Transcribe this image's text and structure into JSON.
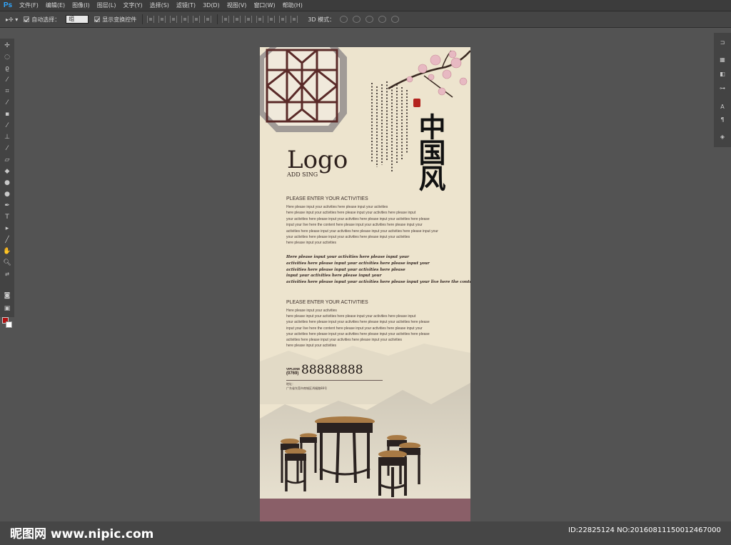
{
  "app": {
    "logo": "Ps"
  },
  "menu": [
    "文件(F)",
    "编辑(E)",
    "图像(I)",
    "图层(L)",
    "文字(Y)",
    "选择(S)",
    "滤镜(T)",
    "3D(D)",
    "视图(V)",
    "窗口(W)",
    "帮助(H)"
  ],
  "options": {
    "auto_select_label": "自动选择：",
    "auto_select_value": "组",
    "show_transform_label": "显示变换控件",
    "mode_3d_label": "3D 模式："
  },
  "poster": {
    "logo": "Logo",
    "logo_sub": "ADD SING",
    "calligraphy": "中国风",
    "heading1": "PLEASE ENTER YOUR ACTIVITIES",
    "body1": [
      "Here please input your activities here please input your activities",
      "here please input your activities here please input your activities here please input",
      "your activities here please input your activities here please input your activities here please",
      "input your live here the content here please input your activities here please input your",
      "activities here please input your activities here please input your activities here please input your",
      "your activities here please input your activities here please input your activities",
      "here please input your activities"
    ],
    "script_lines": [
      "Here please input your activities here please input your",
      "activities here please input your activities here please input your",
      "activities here please input your activities here please",
      "input your activities here please input your",
      "activities here please input your activities here please input your live here the content limities"
    ],
    "heading2": "PLEASE ENTER YOUR ACTIVITIES",
    "body2": [
      "Here please input your activities",
      "here please input your activities here please input your activities here please input",
      "your activities here please input your activities here please input your activities here please",
      "input your live here the content here please input your activities here please input your",
      "your activities here please input your activities here please input your activities here please",
      " activities here please input your activities here please input your activities",
      "here please input your activities"
    ],
    "phone_label": "VIPLENE",
    "phone_area": "(0769)",
    "phone": "88888888",
    "addr_label": "地址：",
    "address": "广东省东莞市南城区鸿福路88号"
  },
  "watermark": {
    "left": "昵图网 www.nipic.com",
    "right": "ID:22825124 NO:20160811150012467000"
  }
}
